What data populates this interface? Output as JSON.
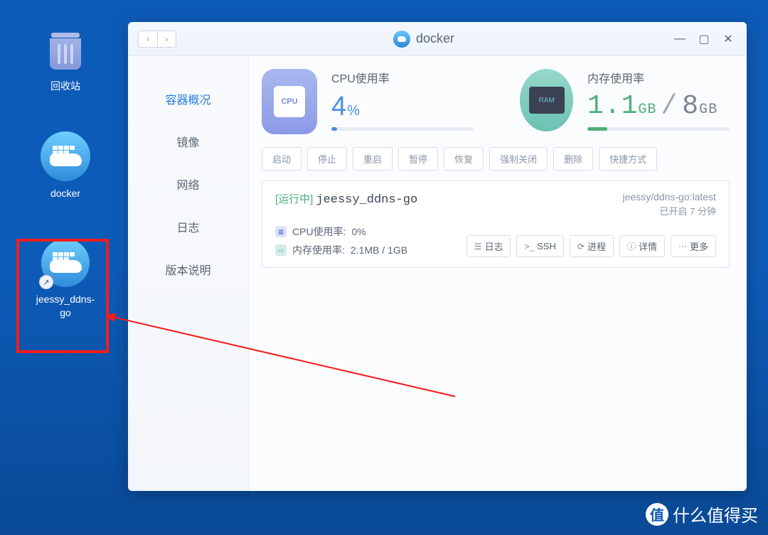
{
  "desktop": {
    "trash_label": "回收站",
    "docker_label": "docker",
    "container_shortcut_label": "jeessy_ddns-go"
  },
  "window": {
    "title": "docker",
    "sidebar": {
      "items": [
        {
          "label": "容器概况",
          "active": true
        },
        {
          "label": "镜像",
          "active": false
        },
        {
          "label": "网络",
          "active": false
        },
        {
          "label": "日志",
          "active": false
        },
        {
          "label": "版本说明",
          "active": false
        }
      ]
    },
    "stats": {
      "cpu": {
        "title": "CPU使用率",
        "value": "4",
        "unit": "%",
        "percent": 4
      },
      "mem": {
        "title": "内存使用率",
        "used": "1.1",
        "used_unit": "GB",
        "total": "8",
        "total_unit": "GB",
        "percent": 14
      }
    },
    "toolbar": [
      "启动",
      "停止",
      "重启",
      "暂停",
      "恢复",
      "强制关闭",
      "删除",
      "快捷方式"
    ],
    "container": {
      "status": "[运行中]",
      "name": "jeessy_ddns-go",
      "image": "jeessy/ddns-go:latest",
      "uptime": "已开启 7 分钟",
      "cpu_label": "CPU使用率:",
      "cpu_value": "0%",
      "mem_label": "内存使用率:",
      "mem_value": "2.1MB / 1GB",
      "actions": [
        {
          "icon": "☰",
          "label": "日志"
        },
        {
          "icon": ">_",
          "label": "SSH"
        },
        {
          "icon": "⟳",
          "label": "进程"
        },
        {
          "icon": "ⓘ",
          "label": "详情"
        },
        {
          "icon": "⋯",
          "label": "更多"
        }
      ]
    }
  },
  "watermark": {
    "badge": "值",
    "text": "什么值得买"
  }
}
